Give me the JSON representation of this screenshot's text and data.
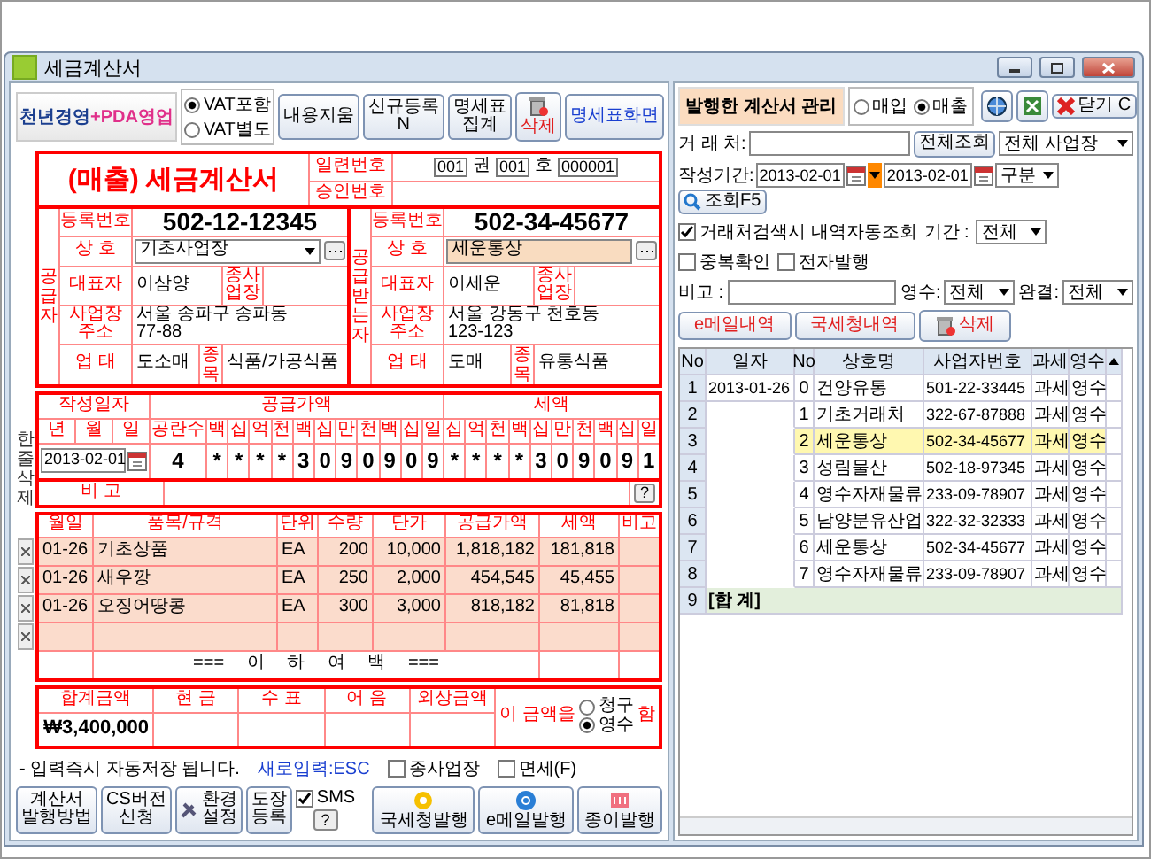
{
  "window": {
    "title": "세금계산서"
  },
  "toolbar": {
    "logo_main": "천년경영",
    "logo_accent": "+PDA영업",
    "vat_options": [
      {
        "label": "VAT포함",
        "selected": true
      },
      {
        "label": "VAT별도",
        "selected": false
      }
    ],
    "buttons": [
      {
        "label": "내용지움",
        "kind": "text"
      },
      {
        "label": "신규등록\nN",
        "kind": "text"
      },
      {
        "label": "명세표\n집계",
        "kind": "text"
      },
      {
        "label": "삭제",
        "kind": "delete"
      },
      {
        "label": "명세표화면",
        "kind": "link"
      }
    ]
  },
  "invoice": {
    "title": "(매출) 세금계산서",
    "serial_label": "일련번호",
    "book_no": "001",
    "book_unit": "권",
    "issue_no": "001",
    "issue_unit": "호",
    "serial_no": "000001",
    "approval_label": "승인번호",
    "parties": [
      {
        "side_label": "공급자",
        "reg_label": "등록번호",
        "reg_no": "502-12-12345",
        "name_label": "상 호",
        "name": "기초사업장",
        "ceo_label": "대표자",
        "ceo": "이삼양",
        "branch_label": "종사업장",
        "addr_label": "사업장 주소",
        "address": [
          "서울 송파구 송파동",
          "77-88"
        ],
        "biz_type_label": "업 태",
        "biz_type": "도소매",
        "item_label": "종목",
        "item": "식품/가공식품"
      },
      {
        "side_label": "공급받는자",
        "reg_label": "등록번호",
        "reg_no": "502-34-45677",
        "name_label": "상 호",
        "name": "세운통상",
        "ceo_label": "대표자",
        "ceo": "이세운",
        "branch_label": "종사업장",
        "addr_label": "사업장 주소",
        "address": [
          "서울 강동구 천호동",
          "123-123"
        ],
        "biz_type_label": "업 태",
        "biz_type": "도매",
        "item_label": "종목",
        "item": "유통식품"
      }
    ],
    "amounts": {
      "date_label": "작성일자",
      "date_heads": [
        "년",
        "월",
        "일"
      ],
      "supply_label": "공급가액",
      "supply_heads": [
        "공란수",
        "백",
        "십",
        "억",
        "천",
        "백",
        "십",
        "만",
        "천",
        "백",
        "십",
        "일"
      ],
      "tax_label": "세액",
      "tax_heads": [
        "십",
        "억",
        "천",
        "백",
        "십",
        "만",
        "천",
        "백",
        "십",
        "일"
      ],
      "date": "2013-02-01",
      "blank_count": "4",
      "supply_digits": [
        "*",
        "*",
        "*",
        "*",
        "3",
        "0",
        "9",
        "0",
        "9",
        "0",
        "9"
      ],
      "tax_digits": [
        "*",
        "*",
        "*",
        "*",
        "3",
        "0",
        "9",
        "0",
        "9",
        "1"
      ]
    },
    "row_delete_label": "한줄삭제",
    "remarks": {
      "label": "비 고",
      "help": "?"
    },
    "items": {
      "columns": [
        "월일",
        "품목/규격",
        "단위",
        "수량",
        "단가",
        "공급가액",
        "세액",
        "비고"
      ],
      "rows": [
        [
          "01-26",
          "기초상품",
          "EA",
          "200",
          "10,000",
          "1,818,182",
          "181,818"
        ],
        [
          "01-26",
          "새우깡",
          "EA",
          "250",
          "2,000",
          "454,545",
          "45,455"
        ],
        [
          "01-26",
          "오징어땅콩",
          "EA",
          "300",
          "3,000",
          "818,182",
          "81,818"
        ]
      ],
      "end_note": "=== 이 하 여 백 ==="
    },
    "totals": {
      "columns": [
        "합계금액",
        "현 금",
        "수 표",
        "어 음",
        "외상금액"
      ],
      "total": "₩3,400,000"
    },
    "claim": {
      "prefix": "이 금액을",
      "options": [
        {
          "label": "청구",
          "selected": false
        },
        {
          "label": "영수",
          "selected": true
        }
      ],
      "suffix": "함"
    }
  },
  "footer": {
    "note": "- 입력즉시 자동저장 됩니다.",
    "hint": "새로입력:ESC",
    "checks": [
      {
        "label": "종사업장",
        "checked": false
      },
      {
        "label": "면세(F)",
        "checked": false
      }
    ],
    "buttons": [
      "계산서\n발행방법",
      "CS버전\n신청",
      "환경\n설정",
      "도장\n등록"
    ],
    "sms": {
      "label": "SMS",
      "checked": true,
      "help": "?"
    },
    "issue_buttons": [
      "국세청발행",
      "e메일발행",
      "종이발행"
    ]
  },
  "manager": {
    "title": "발행한 계산서 관리",
    "modes": [
      {
        "label": "매입",
        "selected": false
      },
      {
        "label": "매출",
        "selected": true
      }
    ],
    "close_label": "닫기 C",
    "partner_label": "거 래 처:",
    "search_all": "전체조회",
    "site_select": "전체 사업장",
    "period_label": "작성기간:",
    "date_from": "2013-02-01",
    "date_to": "2013-02-01",
    "type_select": "구분",
    "query": "조회F5",
    "auto_query": {
      "label": "거래처검색시 내역자동조회",
      "checked": true
    },
    "range_label": "기간 :",
    "range_select": "전체",
    "dup_check": {
      "label": "중복확인",
      "checked": false
    },
    "e_issue": {
      "label": "전자발행",
      "checked": false
    },
    "memo_label": "비고 :",
    "receipt_label": "영수:",
    "receipt_select": "전체",
    "done_label": "완결:",
    "done_select": "전체",
    "actions": [
      {
        "label": "e메일내역",
        "kind": "text"
      },
      {
        "label": "국세청내역",
        "kind": "text"
      },
      {
        "label": "삭제",
        "kind": "delete"
      }
    ],
    "table": {
      "columns": [
        "No",
        "일자",
        "No",
        "상호명",
        "사업자번호",
        "과세",
        "영수"
      ],
      "rows": [
        {
          "kind": "entry",
          "no": "1",
          "date": "2013-01-26",
          "seq": "0",
          "name": "건양유통",
          "biz_no": "501-22-33445",
          "tax": "과세",
          "receipt": "영수",
          "selected": false
        },
        {
          "kind": "entry",
          "no": "2",
          "seq": "1",
          "name": "기초거래처",
          "biz_no": "322-67-87888",
          "tax": "과세",
          "receipt": "영수",
          "selected": false
        },
        {
          "kind": "entry",
          "no": "3",
          "seq": "2",
          "name": "세운통상",
          "biz_no": "502-34-45677",
          "tax": "과세",
          "receipt": "영수",
          "selected": true
        },
        {
          "kind": "entry",
          "no": "4",
          "seq": "3",
          "name": "성림물산",
          "biz_no": "502-18-97345",
          "tax": "과세",
          "receipt": "영수",
          "selected": false
        },
        {
          "kind": "entry",
          "no": "5",
          "seq": "4",
          "name": "영수자재물류",
          "biz_no": "233-09-78907",
          "tax": "과세",
          "receipt": "영수",
          "selected": false
        },
        {
          "kind": "entry",
          "no": "6",
          "seq": "5",
          "name": "남양분유산업",
          "biz_no": "322-32-32333",
          "tax": "과세",
          "receipt": "영수",
          "selected": false
        },
        {
          "kind": "entry",
          "no": "7",
          "seq": "6",
          "name": "세운통상",
          "biz_no": "502-34-45677",
          "tax": "과세",
          "receipt": "영수",
          "selected": false
        },
        {
          "kind": "entry",
          "no": "8",
          "seq": "7",
          "name": "영수자재물류",
          "biz_no": "233-09-78907",
          "tax": "과세",
          "receipt": "영수",
          "selected": false
        },
        {
          "kind": "total",
          "no": "9",
          "label": "[합 계]",
          "selected": false
        }
      ]
    }
  }
}
